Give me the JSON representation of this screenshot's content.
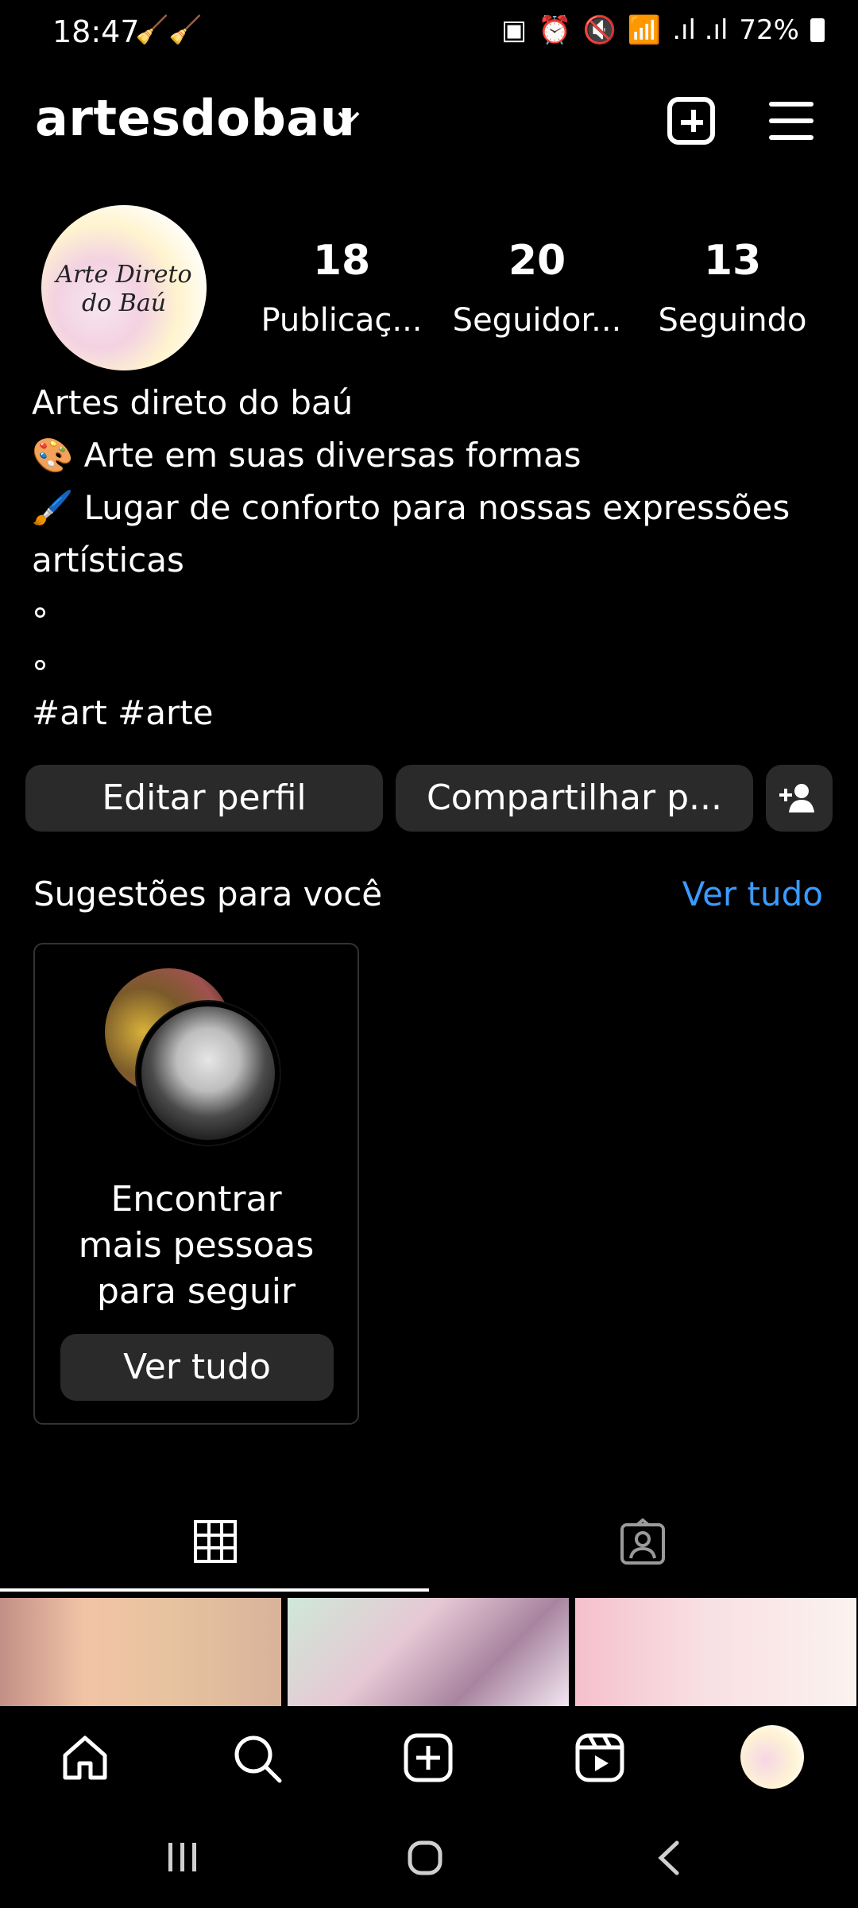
{
  "status": {
    "time": "18:47",
    "battery": "72%"
  },
  "header": {
    "username": "artesdobau",
    "avatar_logo_text_1": "Arte Direto",
    "avatar_logo_text_2": "do Baú"
  },
  "stats": [
    {
      "value": "18",
      "label": "Publicaç..."
    },
    {
      "value": "20",
      "label": "Seguidor..."
    },
    {
      "value": "13",
      "label": "Seguindo"
    }
  ],
  "bio": {
    "name": "Artes direto do baú",
    "line1": "🎨 Arte em suas diversas formas",
    "line2": "🖌️ Lugar de conforto para nossas expressões",
    "line3": "artísticas",
    "dot1": "°",
    "dot2": "°",
    "hashtags": "#art #arte"
  },
  "buttons": {
    "edit": "Editar perfil",
    "share": "Compartilhar p..."
  },
  "suggestions": {
    "title": "Sugestões para você",
    "see_all": "Ver tudo",
    "card_line1": "Encontrar",
    "card_line2": "mais pessoas",
    "card_line3": "para seguir",
    "card_button": "Ver tudo"
  },
  "icons": {
    "header": [
      "chevron-down-icon",
      "create-post-icon",
      "menu-icon"
    ],
    "tabs": [
      "grid-icon",
      "tagged-icon"
    ],
    "bottom_nav": [
      "home-icon",
      "search-icon",
      "create-icon",
      "reels-icon",
      "profile-avatar"
    ],
    "system_nav": [
      "recents-icon",
      "home-circle-icon",
      "back-icon"
    ]
  },
  "colors": {
    "background": "#000000",
    "button": "#2a2a2a",
    "link": "#3b9bff"
  }
}
